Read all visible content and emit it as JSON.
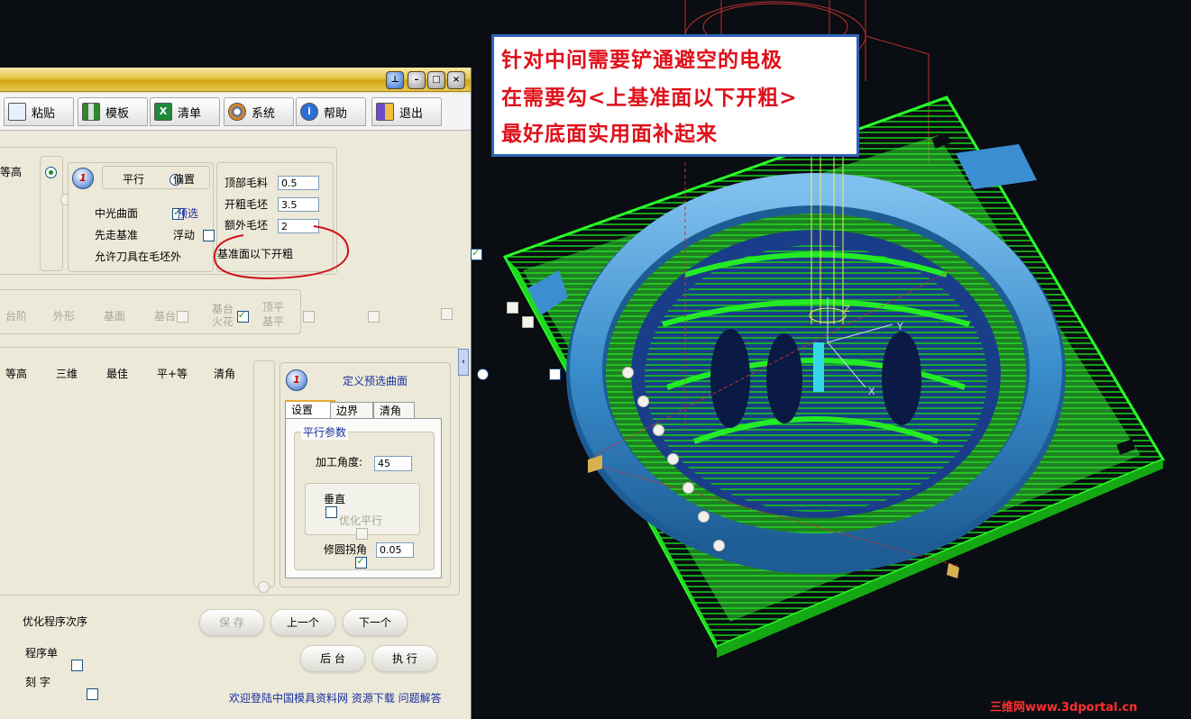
{
  "toolbar": {
    "items": [
      {
        "label": "粘贴",
        "icon": "paste-icon"
      },
      {
        "label": "模板",
        "icon": "template-icon"
      },
      {
        "label": "清单",
        "icon": "excel-list-icon"
      },
      {
        "label": "系统",
        "icon": "gear-system-icon"
      },
      {
        "label": "帮助",
        "icon": "help-icon"
      },
      {
        "label": "退出",
        "icon": "exit-door-icon"
      }
    ]
  },
  "window_controls": {
    "pin": "pin-icon",
    "minimize": "minimize-icon",
    "maximize": "maximize-icon",
    "close": "close-icon"
  },
  "roughing": {
    "partial_label": "等高",
    "badge": "1",
    "mode_options": [
      "平行",
      "偏置"
    ],
    "mode_selected": "偏置",
    "checks": [
      {
        "label": "中光曲面",
        "checked": true
      },
      {
        "label": "预选",
        "checked": false,
        "link": true
      },
      {
        "label": "先走基准",
        "checked": false
      },
      {
        "label": "浮动",
        "checked": false
      },
      {
        "label": "允许刀具在毛坯外",
        "checked": false
      }
    ],
    "params": [
      {
        "label": "顶部毛料",
        "value": "0.5"
      },
      {
        "label": "开粗毛坯",
        "value": "3.5"
      },
      {
        "label": "额外毛坯",
        "value": "2"
      }
    ],
    "below_base": {
      "label": "基准面以下开粗",
      "checked": true
    }
  },
  "features": {
    "items": [
      "台阶",
      "外形",
      "基面",
      "基台"
    ],
    "item_step_checked": false,
    "item_outline_checked": true,
    "group2": [
      "基台",
      "火花"
    ],
    "group3": [
      "顶平",
      "基平"
    ]
  },
  "finishing": {
    "options": [
      "等高",
      "三维",
      "最佳",
      "平+等"
    ],
    "clear_corner": "清角",
    "badge": "1",
    "define_label": "定义预选曲面",
    "tabs": [
      "设置",
      "边界",
      "清角"
    ],
    "active_tab": "设置",
    "group_title": "平行参数",
    "angle_label": "加工角度:",
    "angle_value": "45",
    "vertical_label": "垂直",
    "optimize_label": "优化平行",
    "fillet_label": "修圆拐角",
    "fillet_value": "0.05"
  },
  "bottom": {
    "optimize_order": "优化程序次序",
    "program_sheet": "程序单",
    "engrave": "刻 字",
    "buttons": {
      "save": "保 存",
      "prev": "上一个",
      "next": "下一个",
      "background": "后 台",
      "execute": "执 行"
    },
    "footer": "欢迎登陆中国模具资料网 资源下载 问题解答"
  },
  "annotation": {
    "lines": [
      "针对中间需要铲通避空的电极",
      "在需要勾<上基准面以下开粗>",
      "最好底面实用面补起来"
    ]
  },
  "viewport": {
    "axis_y": "Y",
    "axis_x": "X",
    "axis_z": "Z",
    "watermark": "三维网www.3dportal.cn"
  },
  "colors": {
    "toolpath": "#22ee22",
    "surface": "#4a9fd8",
    "annotation_text": "#e0101a",
    "annotation_border": "#2f63b8",
    "highlight_circle": "#d0101a"
  }
}
